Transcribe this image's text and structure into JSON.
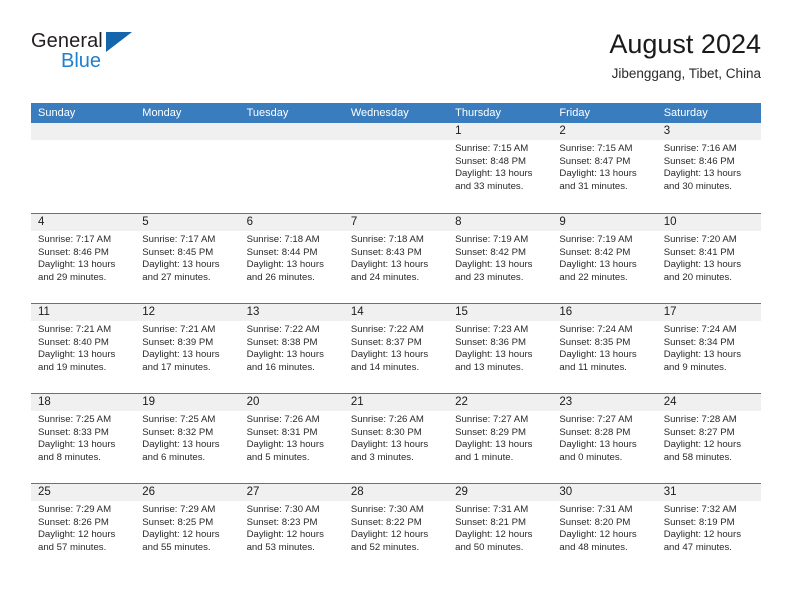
{
  "brand": {
    "name_part1": "General",
    "name_part2": "Blue",
    "flag_icon": "triangle-flag-icon"
  },
  "header": {
    "title": "August 2024",
    "subtitle": "Jibenggang, Tibet, China"
  },
  "calendar": {
    "weekdays": [
      "Sunday",
      "Monday",
      "Tuesday",
      "Wednesday",
      "Thursday",
      "Friday",
      "Saturday"
    ],
    "colors": {
      "header_blue": "#3a7dbf",
      "daynum_band": "#f0f0f0",
      "brand_blue": "#1f7fd0",
      "flag_blue": "#1565ac"
    },
    "weeks": [
      [
        {
          "day": "",
          "empty": true
        },
        {
          "day": "",
          "empty": true
        },
        {
          "day": "",
          "empty": true
        },
        {
          "day": "",
          "empty": true
        },
        {
          "day": "1",
          "sunrise": "Sunrise: 7:15 AM",
          "sunset": "Sunset: 8:48 PM",
          "daylight1": "Daylight: 13 hours",
          "daylight2": "and 33 minutes."
        },
        {
          "day": "2",
          "sunrise": "Sunrise: 7:15 AM",
          "sunset": "Sunset: 8:47 PM",
          "daylight1": "Daylight: 13 hours",
          "daylight2": "and 31 minutes."
        },
        {
          "day": "3",
          "sunrise": "Sunrise: 7:16 AM",
          "sunset": "Sunset: 8:46 PM",
          "daylight1": "Daylight: 13 hours",
          "daylight2": "and 30 minutes."
        }
      ],
      [
        {
          "day": "4",
          "sunrise": "Sunrise: 7:17 AM",
          "sunset": "Sunset: 8:46 PM",
          "daylight1": "Daylight: 13 hours",
          "daylight2": "and 29 minutes."
        },
        {
          "day": "5",
          "sunrise": "Sunrise: 7:17 AM",
          "sunset": "Sunset: 8:45 PM",
          "daylight1": "Daylight: 13 hours",
          "daylight2": "and 27 minutes."
        },
        {
          "day": "6",
          "sunrise": "Sunrise: 7:18 AM",
          "sunset": "Sunset: 8:44 PM",
          "daylight1": "Daylight: 13 hours",
          "daylight2": "and 26 minutes."
        },
        {
          "day": "7",
          "sunrise": "Sunrise: 7:18 AM",
          "sunset": "Sunset: 8:43 PM",
          "daylight1": "Daylight: 13 hours",
          "daylight2": "and 24 minutes."
        },
        {
          "day": "8",
          "sunrise": "Sunrise: 7:19 AM",
          "sunset": "Sunset: 8:42 PM",
          "daylight1": "Daylight: 13 hours",
          "daylight2": "and 23 minutes."
        },
        {
          "day": "9",
          "sunrise": "Sunrise: 7:19 AM",
          "sunset": "Sunset: 8:42 PM",
          "daylight1": "Daylight: 13 hours",
          "daylight2": "and 22 minutes."
        },
        {
          "day": "10",
          "sunrise": "Sunrise: 7:20 AM",
          "sunset": "Sunset: 8:41 PM",
          "daylight1": "Daylight: 13 hours",
          "daylight2": "and 20 minutes."
        }
      ],
      [
        {
          "day": "11",
          "sunrise": "Sunrise: 7:21 AM",
          "sunset": "Sunset: 8:40 PM",
          "daylight1": "Daylight: 13 hours",
          "daylight2": "and 19 minutes."
        },
        {
          "day": "12",
          "sunrise": "Sunrise: 7:21 AM",
          "sunset": "Sunset: 8:39 PM",
          "daylight1": "Daylight: 13 hours",
          "daylight2": "and 17 minutes."
        },
        {
          "day": "13",
          "sunrise": "Sunrise: 7:22 AM",
          "sunset": "Sunset: 8:38 PM",
          "daylight1": "Daylight: 13 hours",
          "daylight2": "and 16 minutes."
        },
        {
          "day": "14",
          "sunrise": "Sunrise: 7:22 AM",
          "sunset": "Sunset: 8:37 PM",
          "daylight1": "Daylight: 13 hours",
          "daylight2": "and 14 minutes."
        },
        {
          "day": "15",
          "sunrise": "Sunrise: 7:23 AM",
          "sunset": "Sunset: 8:36 PM",
          "daylight1": "Daylight: 13 hours",
          "daylight2": "and 13 minutes."
        },
        {
          "day": "16",
          "sunrise": "Sunrise: 7:24 AM",
          "sunset": "Sunset: 8:35 PM",
          "daylight1": "Daylight: 13 hours",
          "daylight2": "and 11 minutes."
        },
        {
          "day": "17",
          "sunrise": "Sunrise: 7:24 AM",
          "sunset": "Sunset: 8:34 PM",
          "daylight1": "Daylight: 13 hours",
          "daylight2": "and 9 minutes."
        }
      ],
      [
        {
          "day": "18",
          "sunrise": "Sunrise: 7:25 AM",
          "sunset": "Sunset: 8:33 PM",
          "daylight1": "Daylight: 13 hours",
          "daylight2": "and 8 minutes."
        },
        {
          "day": "19",
          "sunrise": "Sunrise: 7:25 AM",
          "sunset": "Sunset: 8:32 PM",
          "daylight1": "Daylight: 13 hours",
          "daylight2": "and 6 minutes."
        },
        {
          "day": "20",
          "sunrise": "Sunrise: 7:26 AM",
          "sunset": "Sunset: 8:31 PM",
          "daylight1": "Daylight: 13 hours",
          "daylight2": "and 5 minutes."
        },
        {
          "day": "21",
          "sunrise": "Sunrise: 7:26 AM",
          "sunset": "Sunset: 8:30 PM",
          "daylight1": "Daylight: 13 hours",
          "daylight2": "and 3 minutes."
        },
        {
          "day": "22",
          "sunrise": "Sunrise: 7:27 AM",
          "sunset": "Sunset: 8:29 PM",
          "daylight1": "Daylight: 13 hours",
          "daylight2": "and 1 minute."
        },
        {
          "day": "23",
          "sunrise": "Sunrise: 7:27 AM",
          "sunset": "Sunset: 8:28 PM",
          "daylight1": "Daylight: 13 hours",
          "daylight2": "and 0 minutes."
        },
        {
          "day": "24",
          "sunrise": "Sunrise: 7:28 AM",
          "sunset": "Sunset: 8:27 PM",
          "daylight1": "Daylight: 12 hours",
          "daylight2": "and 58 minutes."
        }
      ],
      [
        {
          "day": "25",
          "sunrise": "Sunrise: 7:29 AM",
          "sunset": "Sunset: 8:26 PM",
          "daylight1": "Daylight: 12 hours",
          "daylight2": "and 57 minutes."
        },
        {
          "day": "26",
          "sunrise": "Sunrise: 7:29 AM",
          "sunset": "Sunset: 8:25 PM",
          "daylight1": "Daylight: 12 hours",
          "daylight2": "and 55 minutes."
        },
        {
          "day": "27",
          "sunrise": "Sunrise: 7:30 AM",
          "sunset": "Sunset: 8:23 PM",
          "daylight1": "Daylight: 12 hours",
          "daylight2": "and 53 minutes."
        },
        {
          "day": "28",
          "sunrise": "Sunrise: 7:30 AM",
          "sunset": "Sunset: 8:22 PM",
          "daylight1": "Daylight: 12 hours",
          "daylight2": "and 52 minutes."
        },
        {
          "day": "29",
          "sunrise": "Sunrise: 7:31 AM",
          "sunset": "Sunset: 8:21 PM",
          "daylight1": "Daylight: 12 hours",
          "daylight2": "and 50 minutes."
        },
        {
          "day": "30",
          "sunrise": "Sunrise: 7:31 AM",
          "sunset": "Sunset: 8:20 PM",
          "daylight1": "Daylight: 12 hours",
          "daylight2": "and 48 minutes."
        },
        {
          "day": "31",
          "sunrise": "Sunrise: 7:32 AM",
          "sunset": "Sunset: 8:19 PM",
          "daylight1": "Daylight: 12 hours",
          "daylight2": "and 47 minutes."
        }
      ]
    ]
  }
}
